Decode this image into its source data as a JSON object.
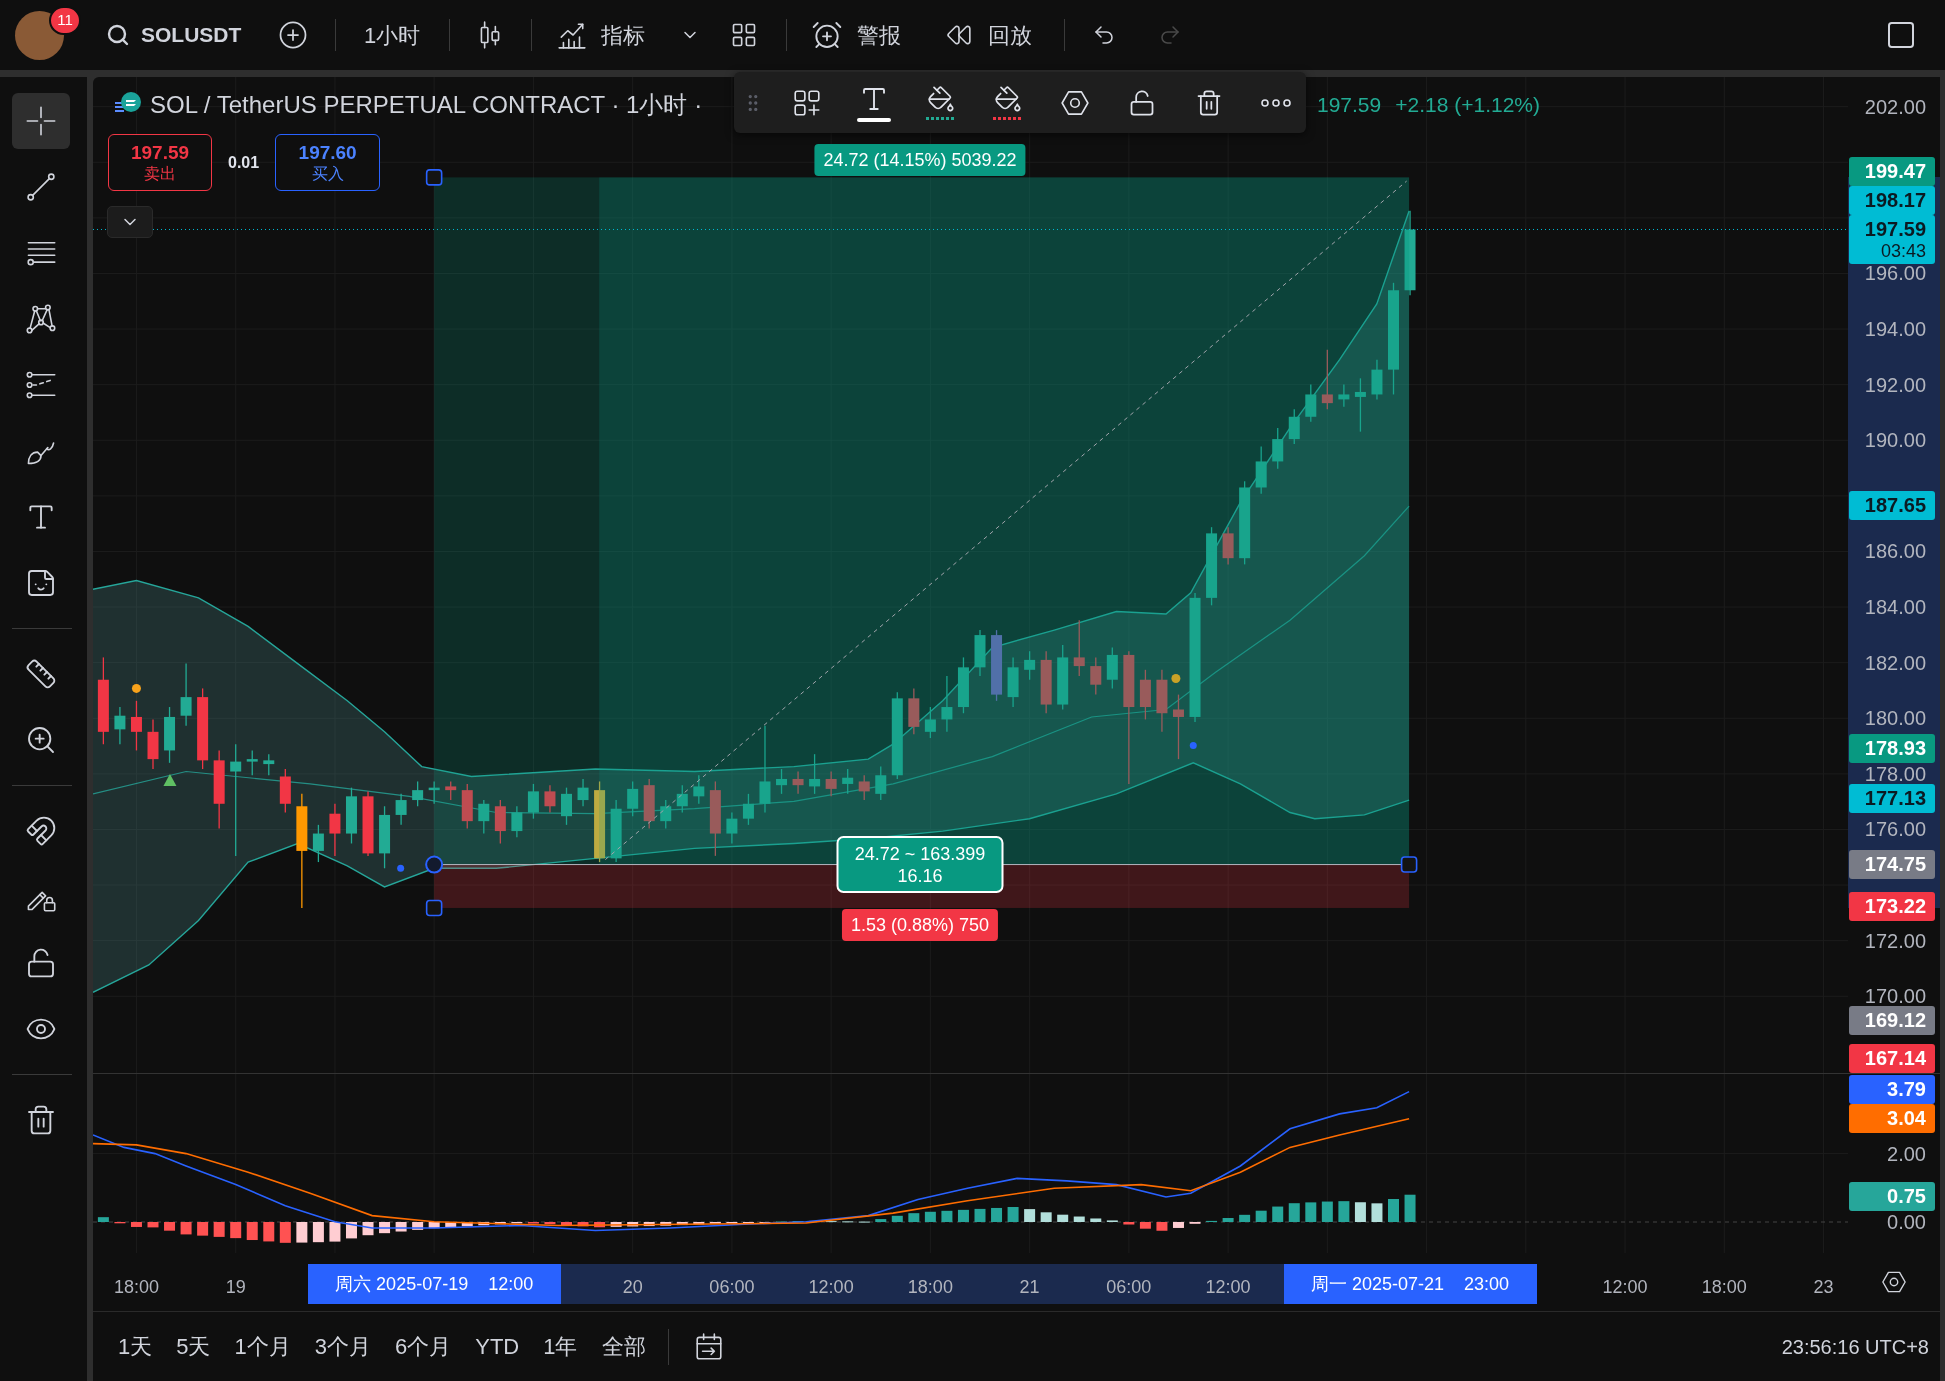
{
  "top_bar": {
    "notification_count": "11",
    "symbol": "SOLUSDT",
    "interval": "1小时",
    "indicators": "指标",
    "alerts": "警报",
    "replay": "回放",
    "undo": {
      "disabled": false
    },
    "redo": {
      "disabled": true
    }
  },
  "left_toolbar": {
    "groups": [
      {
        "tools": [
          {
            "selected": true
          },
          {
            "selected": false
          },
          {
            "selected": false
          },
          {
            "selected": false
          },
          {
            "selected": false
          },
          {
            "selected": false
          },
          {
            "selected": false
          },
          {
            "selected": false
          }
        ]
      },
      {
        "tools": [
          {
            "selected": false
          },
          {
            "selected": false
          }
        ]
      },
      {
        "tools": [
          {
            "selected": false
          },
          {
            "selected": false
          },
          {
            "selected": false
          },
          {
            "selected": false
          }
        ]
      },
      {
        "tools": [
          {
            "selected": false
          }
        ]
      }
    ]
  },
  "chart": {
    "legend": {
      "title": "SOL / TetherUS PERPETUAL CONTRACT · 1小时 ·",
      "close": "197.59",
      "change": "+2.18 (+1.12%)"
    },
    "order_panel": {
      "sell": {
        "price": "197.59",
        "label": "卖出"
      },
      "spread": "0.01",
      "buy": {
        "price": "197.60",
        "label": "买入"
      }
    },
    "drawing_toolbar": {
      "swatches": [
        {
          "kind": "text",
          "color": "#ffffff"
        },
        {
          "kind": "fill",
          "color": "#22ab94"
        },
        {
          "kind": "fill",
          "color": "#f23645"
        }
      ]
    },
    "position_tool": {
      "target_label": "24.72 (14.15%) 5039.22",
      "summary": [
        "24.72 ~ 163.399",
        "16.16"
      ],
      "stop_label": "1.53 (0.88%) 750"
    },
    "price_axis": {
      "ticks": [
        "202.00",
        "196.00",
        "194.00",
        "192.00",
        "190.00",
        "186.00",
        "184.00",
        "182.00",
        "180.00",
        "178.00",
        "176.00",
        "172.00",
        "170.00"
      ],
      "markers": [
        {
          "value": "199.47",
          "color": "#089981"
        },
        {
          "value": "198.17",
          "color": "#00bcd4"
        },
        {
          "value": "197.59",
          "countdown": "03:43",
          "color": "#00bcd4"
        },
        {
          "value": "187.65",
          "color": "#00bcd4"
        },
        {
          "value": "178.93",
          "color": "#089981"
        },
        {
          "value": "177.13",
          "color": "#00bcd4"
        },
        {
          "value": "174.75",
          "color": "#787b86"
        },
        {
          "value": "173.22",
          "color": "#f23645"
        },
        {
          "value": "169.12",
          "color": "#787b86"
        },
        {
          "value": "167.14",
          "color": "#f23645"
        }
      ]
    },
    "macd_axis": {
      "ticks": [
        "2.00",
        "0.00"
      ],
      "markers": [
        {
          "value": "3.79",
          "color": "#2962ff"
        },
        {
          "value": "3.04",
          "color": "#ff6d00"
        },
        {
          "value": "0.75",
          "color": "#26a69a"
        }
      ]
    }
  },
  "time_axis": {
    "labels": [
      "18:00",
      "19",
      "20",
      "06:00",
      "12:00",
      "18:00",
      "21",
      "06:00",
      "12:00",
      "12:00",
      "18:00",
      "23"
    ],
    "crosshair_labels": [
      {
        "date": "周六 2025-07-19",
        "time": "12:00"
      },
      {
        "date": "周一 2025-07-21",
        "time": "23:00"
      }
    ]
  },
  "bottom_bar": {
    "ranges": [
      "1天",
      "5天",
      "1个月",
      "3个月",
      "6个月",
      "YTD",
      "1年",
      "全部"
    ],
    "clock": "23:56:16 UTC+8"
  }
}
